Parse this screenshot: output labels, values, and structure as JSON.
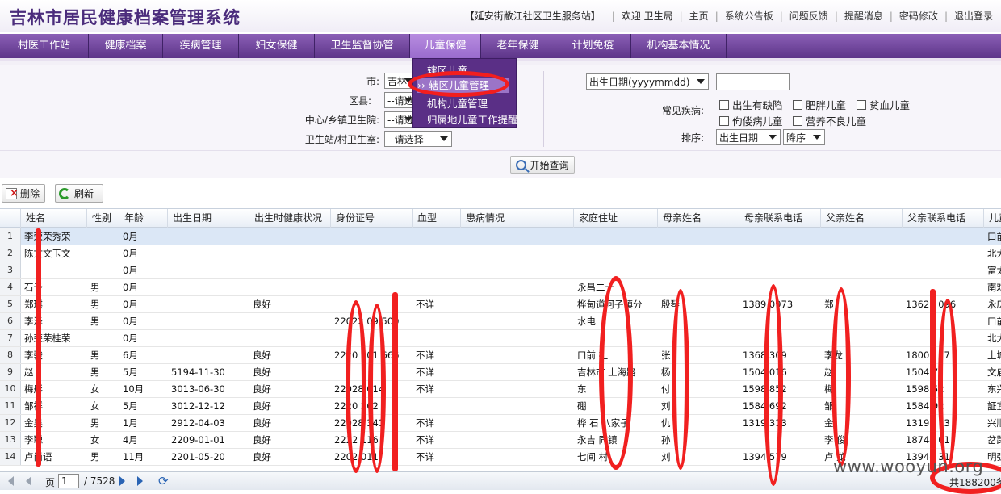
{
  "header": {
    "title": "吉林市居民健康档案管理系统",
    "org": "【延安街敝江社区卫生服务站】",
    "welcome": "欢迎",
    "user": "卫生局",
    "links": [
      "主页",
      "系统公告板",
      "问题反馈",
      "提醒消息",
      "密码修改",
      "退出登录"
    ]
  },
  "nav": {
    "items": [
      "村医工作站",
      "健康档案",
      "疾病管理",
      "妇女保健",
      "卫生监督协管",
      "儿童保健",
      "老年保健",
      "计划免疫",
      "机构基本情况"
    ],
    "active": "儿童保健"
  },
  "submenu": {
    "items": [
      "辖区儿童",
      "›› 辖区儿童管理",
      "机构儿童管理",
      "归属地儿童工作提醒"
    ],
    "highlighted": "›› 辖区儿童管理"
  },
  "filter": {
    "city_label": "市:",
    "city_value": "吉林",
    "district_label": "区县:",
    "district_value": "--请选",
    "center_label": "中心/乡镇卫生院:",
    "center_value": "--请选",
    "station_label": "卫生站/村卫生室:",
    "station_value": "--请选择--",
    "date_select": "出生日期(yyyymmdd)",
    "disease_label": "常见疾病:",
    "diseases": [
      "出生有缺陷",
      "肥胖儿童",
      "贫血儿童",
      "佝偻病儿童",
      "营养不良儿童"
    ],
    "sort_label": "排序:",
    "sort_field": "出生日期",
    "sort_order": "降序",
    "search_button": "开始查询"
  },
  "toolbar": {
    "delete": "删除",
    "refresh": "刷新"
  },
  "grid": {
    "columns": [
      "姓名",
      "性别",
      "年龄",
      "出生日期",
      "出生时健康状况",
      "身份证号",
      "血型",
      "患病情况",
      "家庭住址",
      "母亲姓名",
      "母亲联系电话",
      "父亲姓名",
      "父亲联系电话",
      "儿童"
    ],
    "rows": [
      {
        "n": "1",
        "name": "李荣荣秀荣",
        "sex": "",
        "age": "0月",
        "dob": "",
        "health": "",
        "id": "",
        "blood": "",
        "illness": "",
        "addr": "",
        "mother": "",
        "mphone": "",
        "father": "",
        "fphone": "",
        "extra": "口前"
      },
      {
        "n": "2",
        "name": "陈文文玉文",
        "sex": "",
        "age": "0月",
        "dob": "",
        "health": "",
        "id": "",
        "blood": "",
        "illness": "",
        "addr": "",
        "mother": "",
        "mphone": "",
        "father": "",
        "fphone": "",
        "extra": "北大"
      },
      {
        "n": "3",
        "name": "",
        "sex": "",
        "age": "0月",
        "dob": "",
        "health": "",
        "id": "",
        "blood": "",
        "illness": "",
        "addr": "",
        "mother": "",
        "mphone": "",
        "father": "",
        "fphone": "",
        "extra": "富太"
      },
      {
        "n": "4",
        "name": "石予",
        "sex": "男",
        "age": "0月",
        "dob": "",
        "health": "",
        "id": "",
        "blood": "",
        "illness": "",
        "addr": "永昌二十",
        "mother": "",
        "mphone": "",
        "father": "",
        "fphone": "",
        "extra": "南劝"
      },
      {
        "n": "5",
        "name": "郑琪",
        "sex": "男",
        "age": "0月",
        "dob": "",
        "health": "良好",
        "id": "",
        "blood": "不详",
        "illness": "",
        "addr": "桦甸道河子镇分",
        "mother": "殷琴",
        "mphone": "1389 0973",
        "father": "郑",
        "fphone": "13620 096",
        "extra": "永庆"
      },
      {
        "n": "6",
        "name": "李泽",
        "sex": "男",
        "age": "0月",
        "dob": "",
        "health": "",
        "id": "22022 09 500",
        "blood": "",
        "illness": "",
        "addr": "水电",
        "mother": "",
        "mphone": "",
        "father": "",
        "fphone": "",
        "extra": "口前"
      },
      {
        "n": "7",
        "name": "孙荣荣桂荣",
        "sex": "",
        "age": "0月",
        "dob": "",
        "health": "",
        "id": "",
        "blood": "",
        "illness": "",
        "addr": "",
        "mother": "",
        "mphone": "",
        "father": "",
        "fphone": "",
        "extra": "北大"
      },
      {
        "n": "8",
        "name": "李骏",
        "sex": "男",
        "age": "6月",
        "dob": "",
        "health": "良好",
        "id": "2220 101 666",
        "blood": "不详",
        "illness": "",
        "addr": "口前 社",
        "mother": "张",
        "mphone": "1368 309",
        "father": "李龙",
        "fphone": "18003 77",
        "extra": "土城"
      },
      {
        "n": "9",
        "name": "赵",
        "sex": "男",
        "age": "5月",
        "dob": "5194-11-30",
        "health": "良好",
        "id": "",
        "blood": "不详",
        "illness": "",
        "addr": "吉林市 上海路",
        "mother": "杨",
        "mphone": "1504 016",
        "father": "赵",
        "fphone": "1504 71",
        "extra": "文庙"
      },
      {
        "n": "10",
        "name": "梅彤",
        "sex": "女",
        "age": "10月",
        "dob": "3013-06-30",
        "health": "良好",
        "id": "22028 014",
        "blood": "不详",
        "illness": "",
        "addr": "东",
        "mother": "付",
        "mphone": "1598 852",
        "father": "梅",
        "fphone": "1598 52",
        "extra": "东兴"
      },
      {
        "n": "11",
        "name": "邹祥",
        "sex": "女",
        "age": "5月",
        "dob": "3012-12-12",
        "health": "良好",
        "id": "2220 262",
        "blood": "",
        "illness": "",
        "addr": "硼",
        "mother": "刘",
        "mphone": "1584 692",
        "father": "邹",
        "fphone": "1584 92",
        "extra": "証宜"
      },
      {
        "n": "12",
        "name": "金昊",
        "sex": "男",
        "age": "1月",
        "dob": "2912-04-03",
        "health": "良好",
        "id": "22028 341",
        "blood": "不详",
        "illness": "",
        "addr": "桦 石 八家子",
        "mother": "仇",
        "mphone": "1319 313",
        "father": "金",
        "fphone": "13190 13",
        "extra": "兴顺"
      },
      {
        "n": "13",
        "name": "李聪",
        "sex": "女",
        "age": "4月",
        "dob": "2209-01-01",
        "health": "良好",
        "id": "2222 116",
        "blood": "不详",
        "illness": "",
        "addr": "永吉 同镇",
        "mother": "孙",
        "mphone": "",
        "father": "李 俊",
        "fphone": "18744 01",
        "extra": "岔路"
      },
      {
        "n": "14",
        "name": "卢尚语",
        "sex": "男",
        "age": "11月",
        "dob": "2201-05-20",
        "health": "良好",
        "id": "2202 011",
        "blood": "不详",
        "illness": "",
        "addr": "七间 村",
        "mother": "刘",
        "mphone": "1394 579",
        "father": "卢 龙",
        "fphone": "13944 31",
        "extra": "明弘"
      }
    ]
  },
  "pager": {
    "page_label": "页",
    "page_value": "1",
    "total_pages": "/ 7528",
    "total_records": "共188200条,"
  },
  "watermark": "www.wooyun.org",
  "colors": {
    "brand": "#4b2c7c",
    "nav": "#6b3f99",
    "accent": "#9a6bcd",
    "highlight": "#f12020"
  }
}
